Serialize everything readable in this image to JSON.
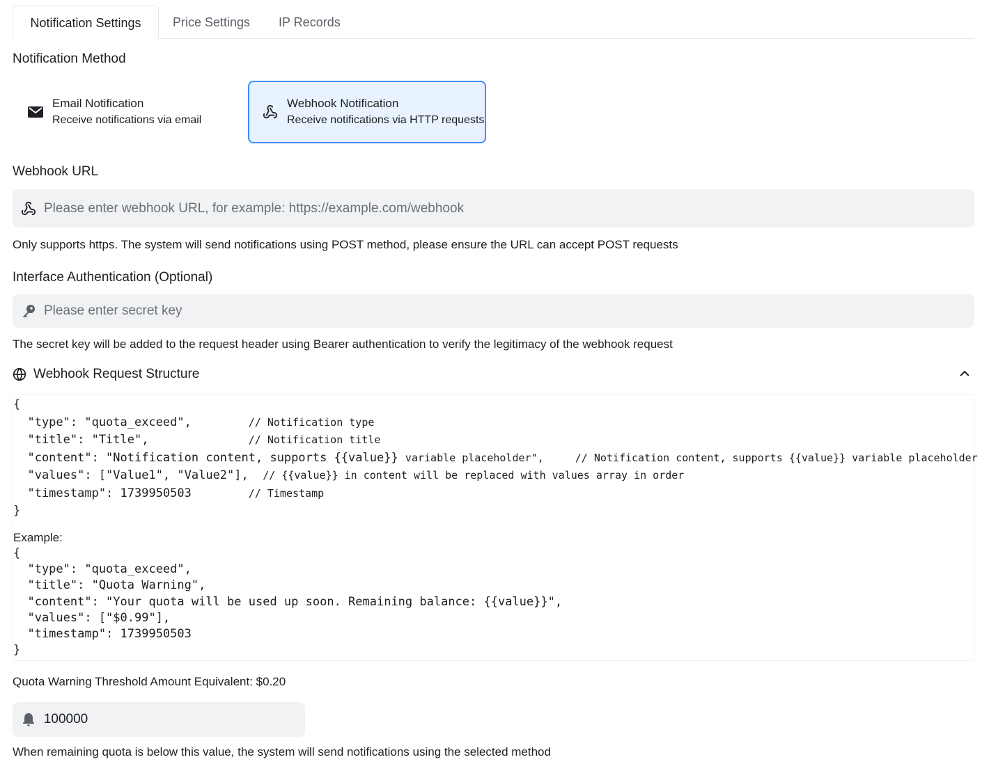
{
  "tabs": [
    {
      "label": "Notification Settings",
      "active": true
    },
    {
      "label": "Price Settings",
      "active": false
    },
    {
      "label": "IP Records",
      "active": false
    }
  ],
  "notification_method": {
    "title": "Notification Method",
    "options": [
      {
        "title": "Email Notification",
        "desc": "Receive notifications via email",
        "icon": "mail-icon",
        "selected": false
      },
      {
        "title": "Webhook Notification",
        "desc": "Receive notifications via HTTP requests",
        "icon": "webhook-icon",
        "selected": true
      }
    ]
  },
  "webhook_url": {
    "label": "Webhook URL",
    "placeholder": "Please enter webhook URL, for example: https://example.com/webhook",
    "value": "",
    "help": "Only supports https. The system will send notifications using POST method, please ensure the URL can accept POST requests"
  },
  "auth": {
    "label": "Interface Authentication (Optional)",
    "placeholder": "Please enter secret key",
    "value": "",
    "help": "The secret key will be added to the request header using Bearer authentication to verify the legitimacy of the webhook request"
  },
  "structure": {
    "title": "Webhook Request Structure",
    "expanded": true,
    "example_label": "Example:"
  },
  "threshold": {
    "label": "Quota Warning Threshold Amount Equivalent: $0.20",
    "value": "100000",
    "help": "When remaining quota is below this value, the system will send notifications using the selected method"
  },
  "colors": {
    "accent": "#3f8cff",
    "selected_bg": "#e8f3ff",
    "input_bg": "#f1f2f3"
  }
}
